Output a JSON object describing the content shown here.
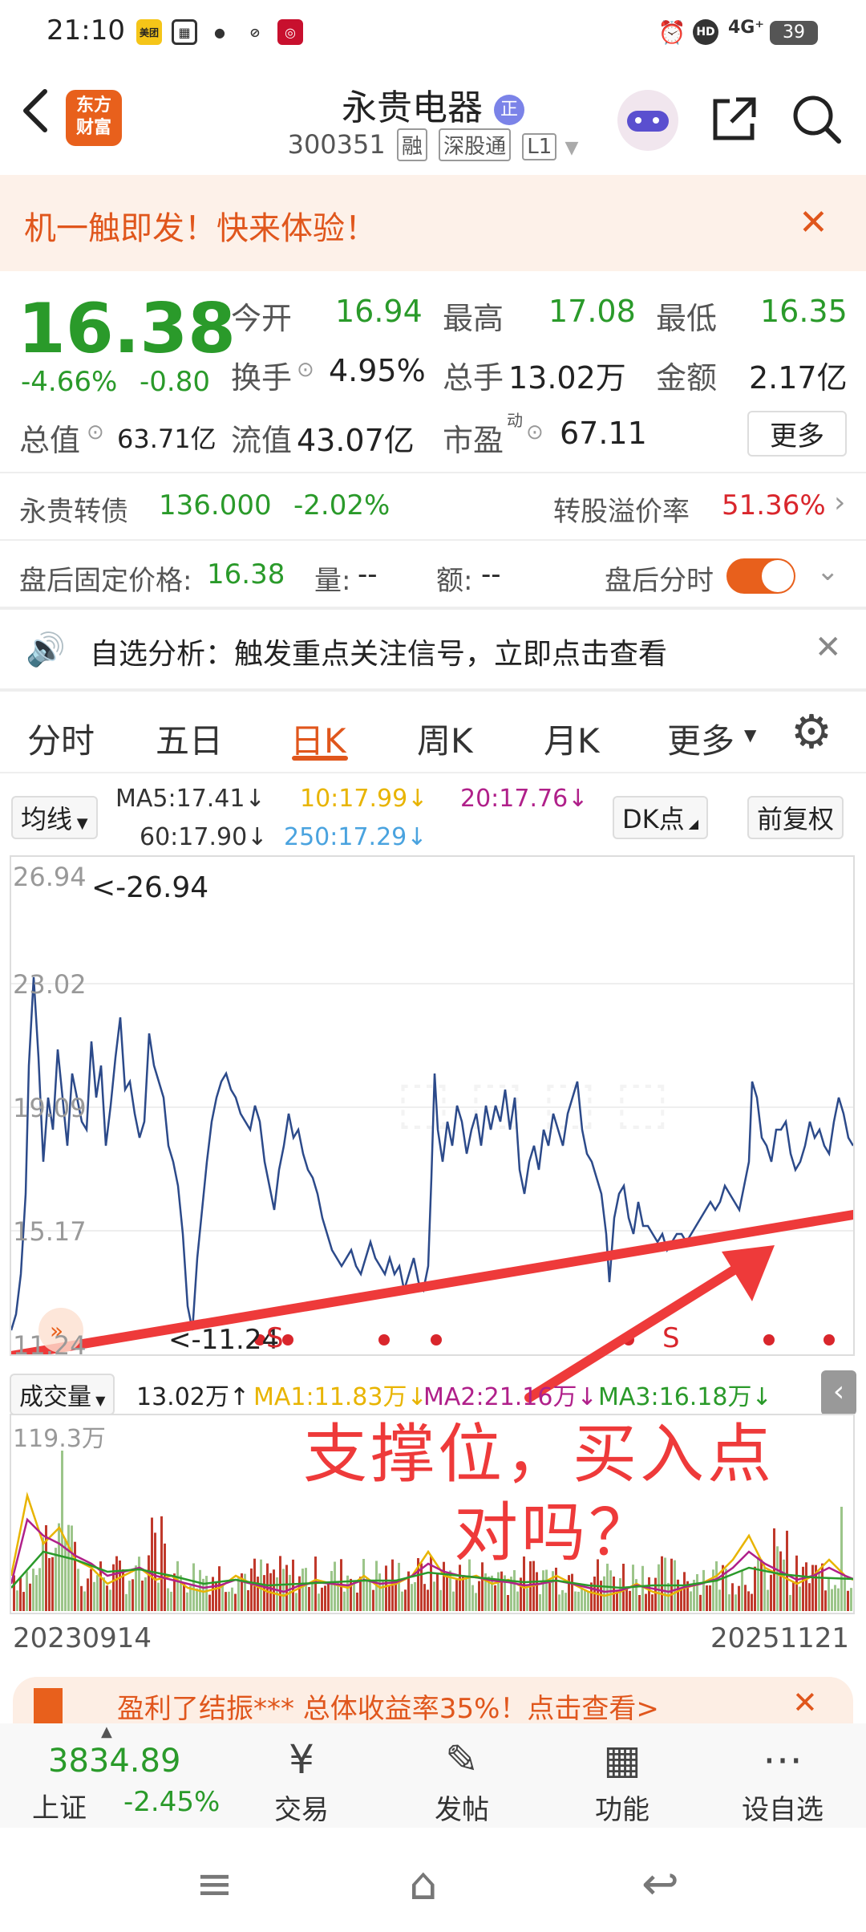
{
  "status_bar": {
    "time": "21:10",
    "network": "4G⁺",
    "battery": "39",
    "app_icons": [
      "美团",
      "pay-icon",
      "wechat-icon",
      "link-icon",
      "bank-icon"
    ]
  },
  "header": {
    "logo_text": "东方\n财富",
    "stock_name": "永贵电器",
    "name_badge": "正",
    "code": "300351",
    "tags": [
      "融",
      "深股通",
      "L1"
    ]
  },
  "banner": {
    "text": "机一触即发！快来体验！"
  },
  "quote": {
    "price": "16.38",
    "change_pct": "-4.66%",
    "change": "-0.80",
    "open_label": "今开",
    "open": "16.94",
    "high_label": "最高",
    "high": "17.08",
    "low_label": "最低",
    "low": "16.35",
    "turnover_label": "换手",
    "turnover": "4.95%",
    "volume_label": "总手",
    "volume": "13.02万",
    "amount_label": "金额",
    "amount": "2.17亿",
    "mcap_label": "总值",
    "mcap": "63.71亿",
    "float_label": "流值",
    "float": "43.07亿",
    "pe_label": "市盈",
    "pe_sup": "动",
    "pe": "67.11",
    "more_button": "更多"
  },
  "bond": {
    "name": "永贵转债",
    "price": "136.000",
    "change": "-2.02%",
    "premium_label": "转股溢价率",
    "premium": "51.36%"
  },
  "after_hours": {
    "fixed_price_label": "盘后固定价格:",
    "fixed_price": "16.38",
    "vol_label": "量:",
    "vol": "--",
    "amt_label": "额:",
    "amt": "--",
    "timeshare_label": "盘后分时"
  },
  "analysis": {
    "text": "自选分析：触发重点关注信号，立即点击查看"
  },
  "tabs": [
    "分时",
    "五日",
    "日K",
    "周K",
    "月K",
    "更多"
  ],
  "ma_legend": {
    "selector": "均线",
    "ma5": "MA5:17.41↓",
    "ma10": "10:17.99↓",
    "ma20": "20:17.76↓",
    "ma60": "60:17.90↓",
    "ma250": "250:17.29↓",
    "dk_button": "DK点",
    "adjust_button": "前复权"
  },
  "price_chart": {
    "y_labels": [
      "26.94",
      "23.02",
      "19.09",
      "15.17",
      "11.24"
    ],
    "max_annotation": "<-26.94",
    "min_annotation": "<-11.24",
    "signal_letters": [
      "S",
      "S"
    ],
    "overlay_text_line1": "支撑位，买入点",
    "overlay_text_line2": "对吗？"
  },
  "volume_legend": {
    "selector": "成交量",
    "vol": "13.02万↑",
    "ma1": "MA1:11.83万↓",
    "ma2": "MA2:21.16万↓",
    "ma3": "MA3:16.18万↓",
    "max_label": "119.3万"
  },
  "dates": {
    "start": "20230914",
    "end": "20251121"
  },
  "promo": {
    "text": "盈利了结振***  总体收益率35%！点击查看>"
  },
  "bottom_nav": {
    "index_value": "3834.89",
    "index_name": "上证",
    "index_change": "-2.45%",
    "items": [
      "交易",
      "发帖",
      "功能",
      "设自选"
    ]
  },
  "colors": {
    "up": "#d9262c",
    "down": "#2a9a2a",
    "accent": "#e0561c",
    "ma5": "#333333",
    "ma10": "#e8b400",
    "ma20": "#b0208a",
    "ma60": "#333333",
    "ma250": "#4aa3df"
  }
}
